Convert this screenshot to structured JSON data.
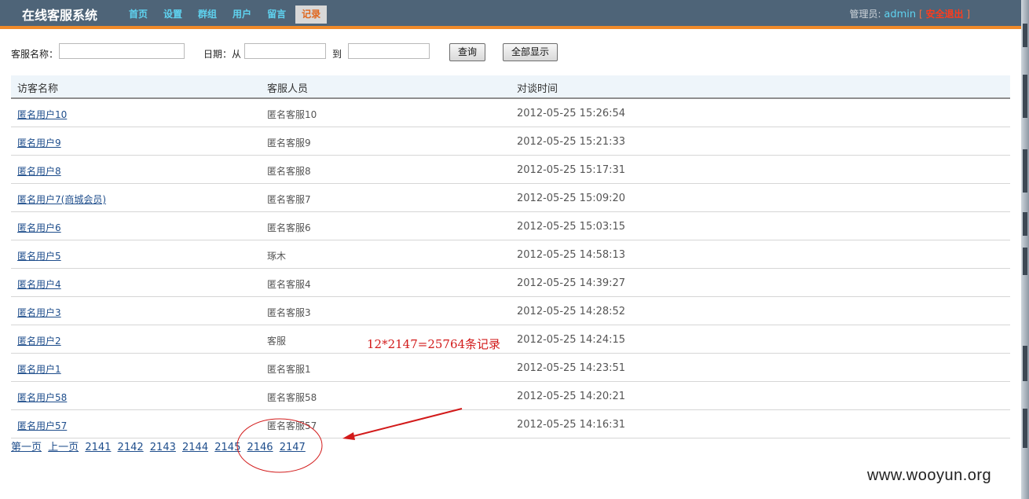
{
  "header": {
    "app_title": "在线客服系统",
    "nav": [
      {
        "label": "首页",
        "active": false
      },
      {
        "label": "设置",
        "active": false
      },
      {
        "label": "群组",
        "active": false
      },
      {
        "label": "用户",
        "active": false
      },
      {
        "label": "留言",
        "active": false
      },
      {
        "label": "记录",
        "active": true
      }
    ],
    "admin_label": "管理员:",
    "admin_name": "admin",
    "bracket_open": "[",
    "logout_label": "安全退出",
    "bracket_close": "]"
  },
  "search": {
    "staff_name_label": "客服名称：",
    "staff_name_value": "",
    "date_label": "日期：从",
    "date_from_value": "",
    "to_label": "到",
    "date_to_value": "",
    "query_button": "查询",
    "show_all_button": "全部显示"
  },
  "table": {
    "columns": [
      "访客名称",
      "客服人员",
      "对谈时间"
    ],
    "rows": [
      {
        "visitor": "匿名用户10",
        "staff": "匿名客服10",
        "time": "2012-05-25 15:26:54"
      },
      {
        "visitor": "匿名用户9",
        "staff": "匿名客服9",
        "time": "2012-05-25 15:21:33"
      },
      {
        "visitor": "匿名用户8",
        "staff": "匿名客服8",
        "time": "2012-05-25 15:17:31"
      },
      {
        "visitor": "匿名用户7(商城会员)",
        "staff": "匿名客服7",
        "time": "2012-05-25 15:09:20"
      },
      {
        "visitor": "匿名用户6",
        "staff": "匿名客服6",
        "time": "2012-05-25 15:03:15"
      },
      {
        "visitor": "匿名用户5",
        "staff": "琢木",
        "time": "2012-05-25 14:58:13"
      },
      {
        "visitor": "匿名用户4",
        "staff": "匿名客服4",
        "time": "2012-05-25 14:39:27"
      },
      {
        "visitor": "匿名用户3",
        "staff": "匿名客服3",
        "time": "2012-05-25 14:28:52"
      },
      {
        "visitor": "匿名用户2",
        "staff": "客服",
        "time": "2012-05-25 14:24:15"
      },
      {
        "visitor": "匿名用户1",
        "staff": "匿名客服1",
        "time": "2012-05-25 14:23:51"
      },
      {
        "visitor": "匿名用户58",
        "staff": "匿名客服58",
        "time": "2012-05-25 14:20:21"
      },
      {
        "visitor": "匿名用户57",
        "staff": "匿名客服57",
        "time": "2012-05-25 14:16:31"
      }
    ]
  },
  "pager": {
    "first": "第一页",
    "prev": "上一页",
    "pages": [
      "2141",
      "2142",
      "2143",
      "2144",
      "2145",
      "2146",
      "2147"
    ]
  },
  "annotation": {
    "text": "12*2147=25764条记录",
    "color": "#d21a1a"
  },
  "watermark": "www.wooyun.org",
  "colors": {
    "header_bg": "#4e6478",
    "header_stripe": "#f08a2a",
    "nav_text": "#5fd3f0",
    "nav_active_text": "#e0661c",
    "logout": "#ff3b1c",
    "link": "#1f4e8c"
  }
}
